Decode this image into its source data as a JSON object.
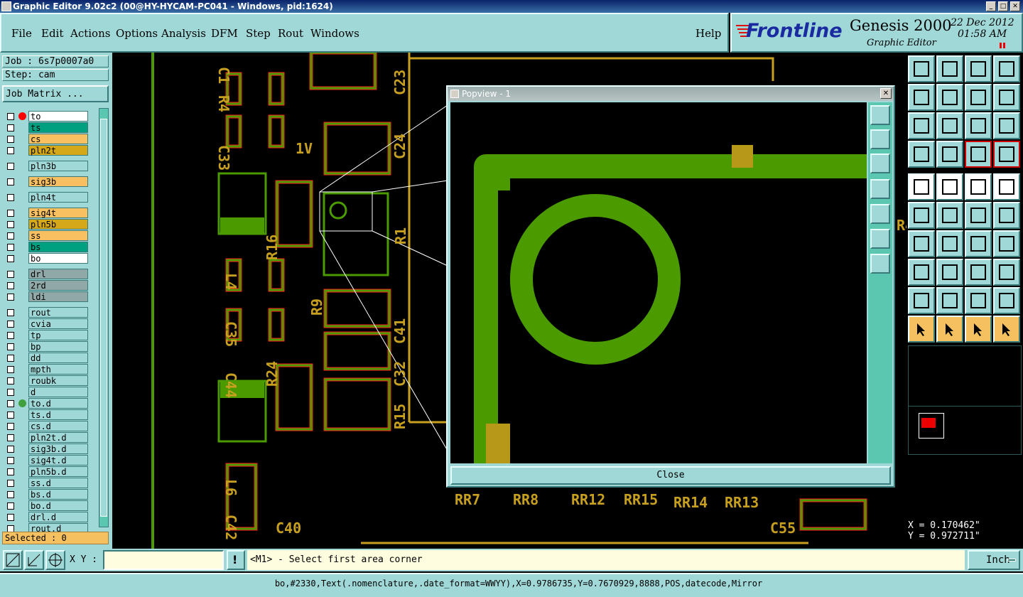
{
  "window": {
    "title": "Graphic Editor 9.02c2 (00@HY-HYCAM-PC041 - Windows, pid:1624)"
  },
  "menu": [
    "File",
    "Edit",
    "Actions",
    "Options",
    "Analysis",
    "DFM",
    "Step",
    "Rout",
    "Windows"
  ],
  "help_label": "Help",
  "brand": {
    "logo": "Frontline",
    "product": "Genesis 2000",
    "subtitle": "Graphic Editor",
    "date": "22 Dec 2012",
    "time": "01:58 AM"
  },
  "job": {
    "job_label": "Job : 6s7p0007a0",
    "step_label": "Step: cam",
    "matrix_button": "Job Matrix ..."
  },
  "layers": [
    {
      "name": "to",
      "color": "#ffffff",
      "dot": "#ff0000"
    },
    {
      "name": "ts",
      "color": "#00a080"
    },
    {
      "name": "cs",
      "color": "#f8c060"
    },
    {
      "name": "pln2t",
      "color": "#d4a818"
    },
    {
      "name": "pln3b",
      "color": "#a0d8d8"
    },
    {
      "name": "sig3b",
      "color": "#f8c060"
    },
    {
      "name": "pln4t",
      "color": "#a0d8d8"
    },
    {
      "name": "sig4t",
      "color": "#f8c060"
    },
    {
      "name": "pln5b",
      "color": "#d4a818"
    },
    {
      "name": "ss",
      "color": "#f8c060"
    },
    {
      "name": "bs",
      "color": "#00a080"
    },
    {
      "name": "bo",
      "color": "#ffffff"
    },
    {
      "name": "drl",
      "color": "#90a8a8"
    },
    {
      "name": "2rd",
      "color": "#90a8a8"
    },
    {
      "name": "ldi",
      "color": "#90a8a8"
    },
    {
      "name": "rout",
      "color": "#a0d8d8"
    },
    {
      "name": "cvia",
      "color": "#a0d8d8"
    },
    {
      "name": "tp",
      "color": "#a0d8d8"
    },
    {
      "name": "bp",
      "color": "#a0d8d8"
    },
    {
      "name": "dd",
      "color": "#a0d8d8"
    },
    {
      "name": "mpth",
      "color": "#a0d8d8"
    },
    {
      "name": "roubk",
      "color": "#a0d8d8"
    },
    {
      "name": "d",
      "color": "#a0d8d8"
    },
    {
      "name": "to.d",
      "color": "#a0d8d8",
      "dot": "#40a040"
    },
    {
      "name": "ts.d",
      "color": "#a0d8d8"
    },
    {
      "name": "cs.d",
      "color": "#a0d8d8"
    },
    {
      "name": "pln2t.d",
      "color": "#a0d8d8"
    },
    {
      "name": "sig3b.d",
      "color": "#a0d8d8"
    },
    {
      "name": "sig4t.d",
      "color": "#a0d8d8"
    },
    {
      "name": "pln5b.d",
      "color": "#a0d8d8"
    },
    {
      "name": "ss.d",
      "color": "#a0d8d8"
    },
    {
      "name": "bs.d",
      "color": "#a0d8d8"
    },
    {
      "name": "bo.d",
      "color": "#a0d8d8"
    },
    {
      "name": "drl.d",
      "color": "#a0d8d8"
    },
    {
      "name": "rout.d",
      "color": "#a0d8d8"
    }
  ],
  "selected_label": "Selected : 0",
  "popview": {
    "title": "Popview - 1",
    "close_label": "Close"
  },
  "coords": {
    "x": "X = 0.170462\"",
    "y": "Y = 0.972711\""
  },
  "bottom": {
    "xy_label": "X Y :",
    "xy_value": "",
    "prompt": "<M1> - Select first area corner",
    "units": "Inch"
  },
  "status": "bo,#2330,Text(.nomenclature,.date_format=WWYY),X=0.9786735,Y=0.7670929,8888,POS,datecode,Mirror",
  "pcb_labels": [
    "C1",
    "R4",
    "C33",
    "1V",
    "C23",
    "C24",
    "R16",
    "R1",
    "L4",
    "C35",
    "R9",
    "C44",
    "R24",
    "C41",
    "C32",
    "R15",
    "L6",
    "C42",
    "C40",
    "RR7",
    "RR8",
    "RR12",
    "RR15",
    "RR14",
    "RR13",
    "C55",
    "R4"
  ],
  "colors": {
    "panel": "#a0d8d8",
    "silk": "#c8a020",
    "pad": "#4a9a00",
    "outline": "#ff2020"
  }
}
